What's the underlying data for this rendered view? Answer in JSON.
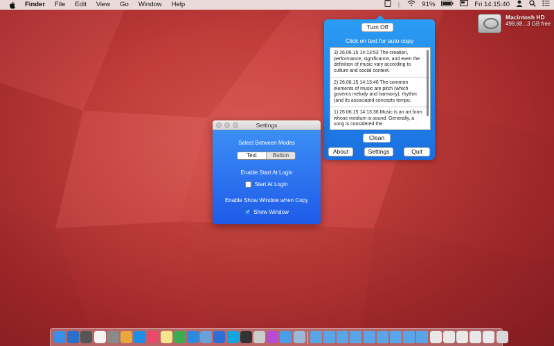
{
  "menubar": {
    "app_name": "Finder",
    "menus": [
      "File",
      "Edit",
      "View",
      "Go",
      "Window",
      "Help"
    ],
    "battery": "91%",
    "clock": "Fri 14:15:40"
  },
  "desktop": {
    "disk_name": "Macintosh HD",
    "disk_info": "498.88...3 GB free"
  },
  "popover": {
    "turn_off_label": "Turn Off",
    "title": "Click on text for auto-copy",
    "entries": [
      "3) 26.06.15 14:13:53    The creation, performance, significance, and even the definition of music vary according to culture and social context.",
      "2) 26.06.15 14:13:46    The common elements of music are pitch (which governs melody and harmony), rhythm (and its associated concepts tempo,",
      "1) 26.06.15 14:13:36    Music is an art form whose medium is sound. Generally, a song is considered the"
    ],
    "clean_label": "Clean",
    "about_label": "About",
    "settings_label": "Settings",
    "quit_label": "Quit"
  },
  "settings": {
    "window_title": "Settings",
    "modes_label": "Select Between Modes",
    "mode_text": "Text",
    "mode_button": "Button",
    "login_heading": "Enable Start At Login",
    "login_checkbox": "Start At Login",
    "login_checked": false,
    "show_heading": "Enable Show Window when Copy",
    "show_checkbox": "Show Window",
    "show_checked": true
  },
  "dock": {
    "icons": [
      {
        "name": "finder-icon",
        "color": "#3a8ee6"
      },
      {
        "name": "dashboard-icon",
        "color": "#2a6fc9"
      },
      {
        "name": "launchpad-icon",
        "color": "#555"
      },
      {
        "name": "calendar-icon",
        "color": "#f4f4f4"
      },
      {
        "name": "photo-browser-icon",
        "color": "#8a8a8a"
      },
      {
        "name": "photos-icon",
        "color": "#e8a840"
      },
      {
        "name": "app-store-icon",
        "color": "#1e8de6"
      },
      {
        "name": "itunes-icon",
        "color": "#e84a6c"
      },
      {
        "name": "notes-icon",
        "color": "#f6e58a"
      },
      {
        "name": "chrome-icon",
        "color": "#3cab52"
      },
      {
        "name": "safari-icon",
        "color": "#2b8ae0"
      },
      {
        "name": "preview-icon",
        "color": "#6aa0d8"
      },
      {
        "name": "xcode-icon",
        "color": "#2f6ed6"
      },
      {
        "name": "skype-icon",
        "color": "#12a6e0"
      },
      {
        "name": "cocoapods-icon",
        "color": "#333"
      },
      {
        "name": "gallery-icon",
        "color": "#ccc"
      },
      {
        "name": "flower-icon",
        "color": "#b84ad6"
      },
      {
        "name": "dropbox-icon",
        "color": "#4a9ee8"
      },
      {
        "name": "package-icon",
        "color": "#9ab8d8"
      },
      {
        "name": "folder-1-icon",
        "color": "#5aa4e8"
      },
      {
        "name": "folder-2-icon",
        "color": "#5aa4e8"
      },
      {
        "name": "folder-3-icon",
        "color": "#5aa4e8"
      },
      {
        "name": "folder-4-icon",
        "color": "#5aa4e8"
      },
      {
        "name": "folder-5-icon",
        "color": "#5aa4e8"
      },
      {
        "name": "folder-6-icon",
        "color": "#5aa4e8"
      },
      {
        "name": "folder-7-icon",
        "color": "#5aa4e8"
      },
      {
        "name": "folder-8-icon",
        "color": "#5aa4e8"
      },
      {
        "name": "folder-9-icon",
        "color": "#5aa4e8"
      },
      {
        "name": "document-1-icon",
        "color": "#e8e8e8"
      },
      {
        "name": "document-2-icon",
        "color": "#e8e8e8"
      },
      {
        "name": "document-3-icon",
        "color": "#e8e8e8"
      },
      {
        "name": "document-4-icon",
        "color": "#e8e8e8"
      },
      {
        "name": "document-5-icon",
        "color": "#e8e8e8"
      },
      {
        "name": "trash-icon",
        "color": "#d8d8d8"
      }
    ]
  }
}
